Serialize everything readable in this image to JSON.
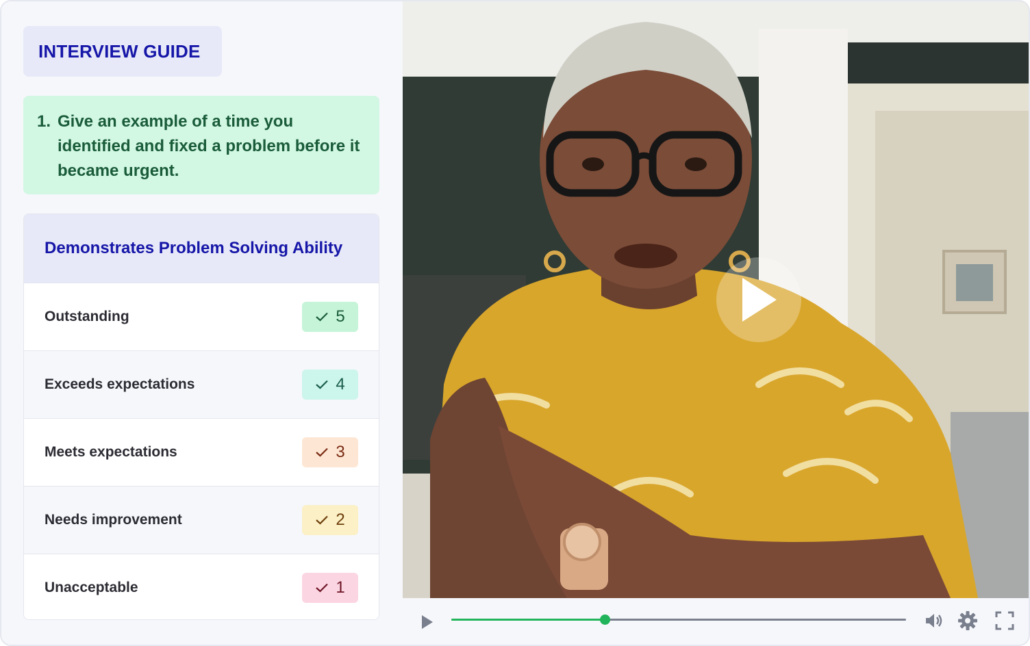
{
  "guide": {
    "title": "INTERVIEW GUIDE"
  },
  "question": {
    "number": "1.",
    "text": "Give an example of a time you identified and fixed a problem before it became urgent."
  },
  "rubric": {
    "title": "Demonstrates Problem Solving Ability",
    "rows": [
      {
        "label": "Outstanding",
        "score": "5",
        "badge_bg": "#c6f4d8",
        "badge_fg": "#1a5c3a"
      },
      {
        "label": "Exceeds expectations",
        "score": "4",
        "badge_bg": "#ccf5ec",
        "badge_fg": "#1a5c4a"
      },
      {
        "label": "Meets expectations",
        "score": "3",
        "badge_bg": "#fde7d4",
        "badge_fg": "#7a2b14"
      },
      {
        "label": "Needs improvement",
        "score": "2",
        "badge_bg": "#fbf0c6",
        "badge_fg": "#6e3e0c"
      },
      {
        "label": "Unacceptable",
        "score": "1",
        "badge_bg": "#fbd6e2",
        "badge_fg": "#6e1426"
      }
    ]
  },
  "player": {
    "progress": 0.337,
    "accent": "#22b45a",
    "icons": [
      "play-icon",
      "volume-icon",
      "settings-icon",
      "fullscreen-icon"
    ]
  }
}
